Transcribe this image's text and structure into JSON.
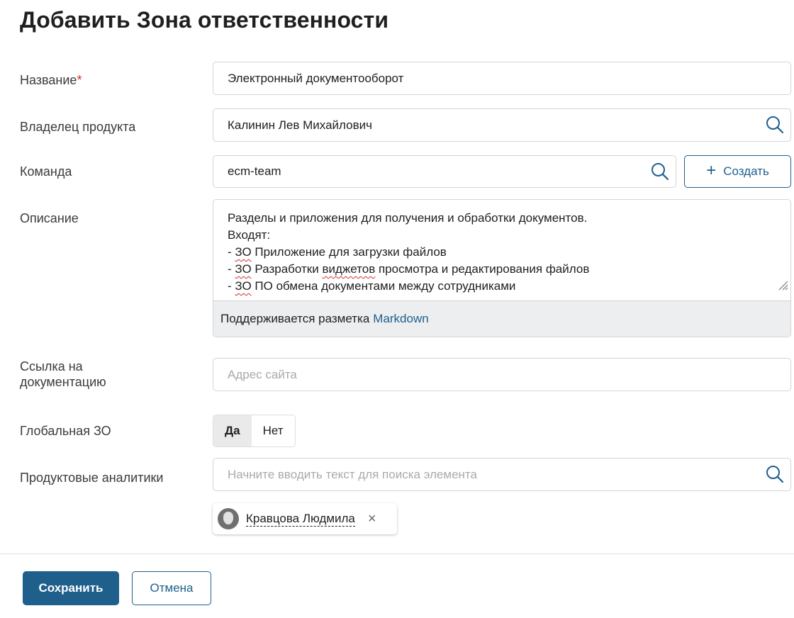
{
  "page": {
    "title": "Добавить Зона ответственности"
  },
  "form": {
    "name": {
      "label": "Название",
      "required_mark": "*",
      "value": "Электронный документооборот"
    },
    "owner": {
      "label": "Владелец продукта",
      "value": "Калинин Лев Михайлович"
    },
    "team": {
      "label": "Команда",
      "value": "ecm-team",
      "create_plus": "+",
      "create_label": "Создать"
    },
    "description": {
      "label": "Описание",
      "line1": "Разделы и приложения для получения и обработки документов.",
      "line2": "Входят:",
      "line3_prefix": "- ",
      "line3_zo": "ЗО",
      "line3_rest": " Приложение для загрузки файлов",
      "line4_prefix": "- ",
      "line4_zo": "ЗО",
      "line4_mid": " Разработки ",
      "line4_widget": "виджетов",
      "line4_rest": " просмотра и редактирования файлов",
      "line5_prefix": "- ",
      "line5_zo": "ЗО",
      "line5_rest": " ПО обмена документами между сотрудниками",
      "footer_text": "Поддерживается разметка",
      "footer_link": "Markdown"
    },
    "doc_link": {
      "label_line1": "Ссылка на",
      "label_line2": "документацию",
      "placeholder": "Адрес сайта"
    },
    "global_zo": {
      "label": "Глобальная ЗО",
      "option_yes": "Да",
      "option_no": "Нет",
      "selected": "Да"
    },
    "analysts": {
      "label": "Продуктовые аналитики",
      "placeholder": "Начните вводить текст для поиска элемента",
      "selected": [
        {
          "name": "Кравцова Людмила",
          "remove": "×"
        }
      ]
    }
  },
  "actions": {
    "save_label": "Сохранить",
    "cancel_label": "Отмена"
  },
  "colors": {
    "accent": "#1f5f8c",
    "required": "#d32f2f",
    "footer_bg": "#eceef0"
  },
  "icons": [
    "search-icon",
    "plus-icon",
    "resize-handle-icon",
    "close-icon",
    "avatar"
  ]
}
